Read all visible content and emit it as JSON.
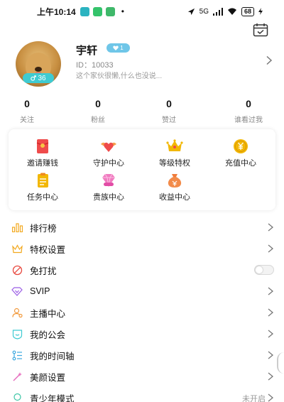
{
  "status_bar": {
    "time": "上午10:14",
    "dot": "•",
    "signal": "5G",
    "battery": "68"
  },
  "profile": {
    "name": "宇轩",
    "vip_level": "1",
    "id_text": "ID：10033",
    "signature": "这个家伙很懒,什么也没说...",
    "avatar_badge": "36"
  },
  "stats": [
    {
      "value": "0",
      "label": "关注"
    },
    {
      "value": "0",
      "label": "粉丝"
    },
    {
      "value": "0",
      "label": "赞过"
    },
    {
      "value": "0",
      "label": "谁看过我"
    }
  ],
  "grid": [
    {
      "label": "邀请赚钱",
      "icon": "red-envelope-icon"
    },
    {
      "label": "守护中心",
      "icon": "winged-heart-icon"
    },
    {
      "label": "等级特权",
      "icon": "crown-icon"
    },
    {
      "label": "充值中心",
      "icon": "yuan-coin-icon"
    },
    {
      "label": "任务中心",
      "icon": "task-clipboard-icon"
    },
    {
      "label": "贵族中心",
      "icon": "vip-diamond-icon"
    },
    {
      "label": "收益中心",
      "icon": "money-bag-icon"
    }
  ],
  "menu": [
    {
      "label": "排行榜",
      "icon": "bar-chart-icon",
      "right": "chevron"
    },
    {
      "label": "特权设置",
      "icon": "crown-outline-icon",
      "right": "chevron"
    },
    {
      "label": "免打扰",
      "icon": "no-disturb-icon",
      "right": "toggle",
      "toggle_on": false
    },
    {
      "label": "SVIP",
      "icon": "svip-icon",
      "right": "chevron"
    },
    {
      "label": "主播中心",
      "icon": "anchor-person-icon",
      "right": "chevron"
    },
    {
      "label": "我的公会",
      "icon": "guild-shield-icon",
      "right": "chevron"
    },
    {
      "label": "我的时间轴",
      "icon": "timeline-icon",
      "right": "chevron"
    },
    {
      "label": "美颜设置",
      "icon": "beauty-wand-icon",
      "right": "chevron"
    },
    {
      "label": "青少年模式",
      "icon": "teen-mode-icon",
      "right": "text",
      "right_text": "未开启"
    }
  ],
  "colors": {
    "teal_accent": "#3ecbd2",
    "vip_blue": "#6fc6e8",
    "gold": "#f2b705",
    "red": "#ef4b4b"
  }
}
